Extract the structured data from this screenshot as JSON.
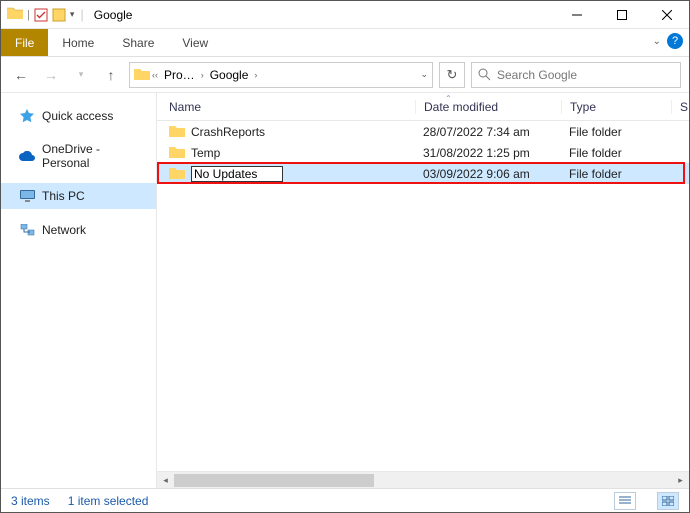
{
  "title": "Google",
  "tabs": {
    "file": "File",
    "home": "Home",
    "share": "Share",
    "view": "View"
  },
  "nav": {
    "crumb1": "Pro…",
    "crumb2": "Google"
  },
  "search": {
    "placeholder": "Search Google"
  },
  "columns": {
    "name": "Name",
    "date": "Date modified",
    "type": "Type",
    "trail": "S"
  },
  "sidebar": {
    "quick": "Quick access",
    "onedrive": "OneDrive - Personal",
    "thispc": "This PC",
    "network": "Network"
  },
  "rows": [
    {
      "name": "CrashReports",
      "date": "28/07/2022 7:34 am",
      "type": "File folder"
    },
    {
      "name": "Temp",
      "date": "31/08/2022 1:25 pm",
      "type": "File folder"
    },
    {
      "name": "No Updates",
      "date": "03/09/2022 9:06 am",
      "type": "File folder"
    }
  ],
  "status": {
    "items": "3 items",
    "selected": "1 item selected"
  }
}
